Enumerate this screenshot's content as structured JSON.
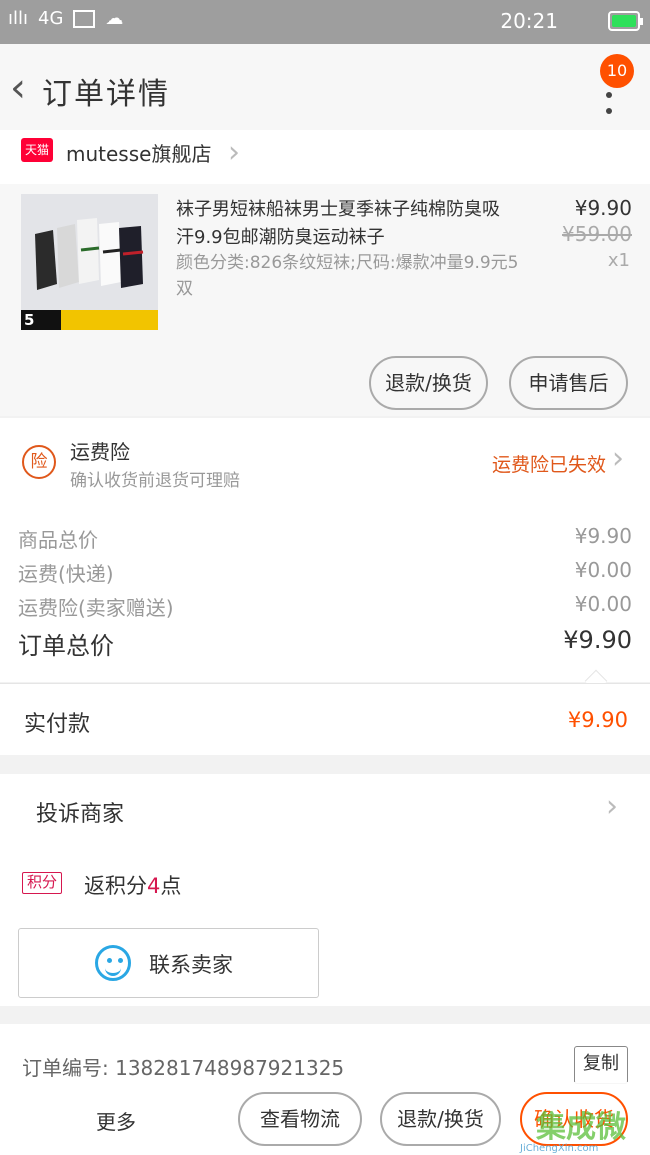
{
  "status_bar": {
    "signal": "4G",
    "time": "20:21"
  },
  "header": {
    "title": "订单详情",
    "badge_count": "10"
  },
  "shop": {
    "brand": "天猫",
    "name": "mutesse旗舰店"
  },
  "product": {
    "title": "袜子男短袜船袜男士夏季袜子纯棉防臭吸汗9.9包邮潮防臭运动袜子",
    "sku": "颜色分类:826条纹短袜;尺码:爆款冲量9.9元5双",
    "price": "¥9.90",
    "original_price": "¥59.00",
    "quantity": "x1",
    "thumb_badge": "5",
    "buttons": [
      "退款/换货",
      "申请售后"
    ]
  },
  "insurance": {
    "icon": "险",
    "title": "运费险",
    "subtitle": "确认收货前退货可理赔",
    "status": "运费险已失效"
  },
  "summary": {
    "rows": [
      {
        "label": "商品总价",
        "value": "¥9.90"
      },
      {
        "label": "运费(快递)",
        "value": "¥0.00"
      },
      {
        "label": "运费险(卖家赠送)",
        "value": "¥0.00"
      }
    ],
    "total_label": "订单总价",
    "total_value": "¥9.90",
    "paid_label": "实付款",
    "paid_value": "¥9.90"
  },
  "complain": {
    "label": "投诉商家"
  },
  "points": {
    "badge": "积分",
    "prefix": "返积分",
    "count": "4",
    "suffix": "点"
  },
  "contact": {
    "label": "联系卖家"
  },
  "order": {
    "number_label": "订单编号:",
    "number": "1382817489879213​25",
    "copy_label": "复制"
  },
  "bottom_bar": {
    "more": "更多",
    "logistics": "查看物流",
    "refund": "退款/换货",
    "confirm": "确认收货"
  },
  "watermark": {
    "text": "集成微信",
    "sub": "JiChengXin.com"
  },
  "colors": {
    "accent": "#ff5000",
    "insurance": "#e0581b",
    "points": "#d6174f",
    "wangwang": "#2aa7e4"
  }
}
